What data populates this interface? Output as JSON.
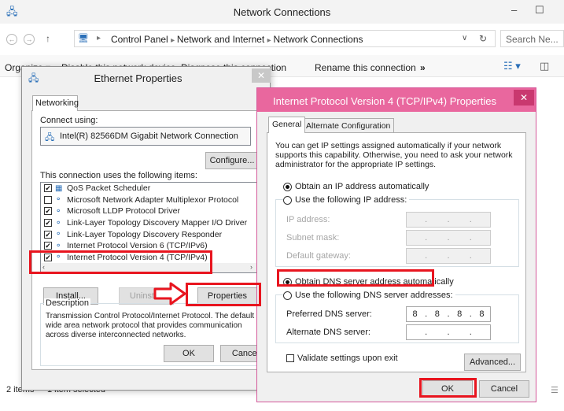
{
  "explorer": {
    "title": "Network Connections",
    "window_controls": [
      "–",
      "☐"
    ],
    "nav": {
      "back": "←",
      "forward": "→",
      "up": "↑"
    },
    "breadcrumbs": [
      "Control Panel",
      "Network and Internet",
      "Network Connections"
    ],
    "search_placeholder": "Search Ne...",
    "toolbar": {
      "organize": "Organize ▾",
      "disable": "Disable this network device",
      "diagnose": "Diagnose this connection",
      "rename": "Rename this connection",
      "more": "»"
    },
    "status": {
      "items": "2 items",
      "selected": "1 item selected"
    }
  },
  "ethernet": {
    "title": "Ethernet Properties",
    "close": "✕",
    "tab": "Networking",
    "connect_using_label": "Connect using:",
    "adapter": "Intel(R) 82566DM Gigabit Network Connection",
    "configure": "Configure...",
    "items_label": "This connection uses the following items:",
    "items": [
      {
        "label": "QoS Packet Scheduler",
        "checked": "✔"
      },
      {
        "label": "Microsoft Network Adapter Multiplexor Protocol",
        "checked": ""
      },
      {
        "label": "Microsoft LLDP Protocol Driver",
        "checked": "✔"
      },
      {
        "label": "Link-Layer Topology Discovery Mapper I/O Driver",
        "checked": "✔"
      },
      {
        "label": "Link-Layer Topology Discovery Responder",
        "checked": "✔"
      },
      {
        "label": "Internet Protocol Version 6 (TCP/IPv6)",
        "checked": "✔"
      },
      {
        "label": "Internet Protocol Version 4 (TCP/IPv4)",
        "checked": "✔"
      }
    ],
    "install": "Install...",
    "uninstall": "Uninstall",
    "properties": "Properties",
    "description_label": "Description",
    "description": "Transmission Control Protocol/Internet Protocol. The default wide area network protocol that provides communication across diverse interconnected networks.",
    "ok": "OK",
    "cancel": "Cancel"
  },
  "ipv4": {
    "title": "Internet Protocol Version 4 (TCP/IPv4) Properties",
    "close": "✕",
    "tabs": [
      "General",
      "Alternate Configuration"
    ],
    "intro": "You can get IP settings assigned automatically if your network supports this capability. Otherwise, you need to ask your network administrator for the appropriate IP settings.",
    "obtain_ip_auto": "Obtain an IP address automatically",
    "use_following_ip": "Use the following IP address:",
    "ip_label": "IP address:",
    "subnet_label": "Subnet mask:",
    "gateway_label": "Default gateway:",
    "obtain_dns_auto": "Obtain DNS server address automatically",
    "use_following_dns": "Use the following DNS server addresses:",
    "preferred_dns_label": "Preferred DNS server:",
    "preferred_dns": [
      "8",
      "8",
      "8",
      "8"
    ],
    "alternate_dns_label": "Alternate DNS server:",
    "validate": "Validate settings upon exit",
    "advanced": "Advanced...",
    "ok": "OK",
    "cancel": "Cancel"
  },
  "colors": {
    "accent_pink": "#e9679e",
    "highlight_red": "#e8151f"
  }
}
